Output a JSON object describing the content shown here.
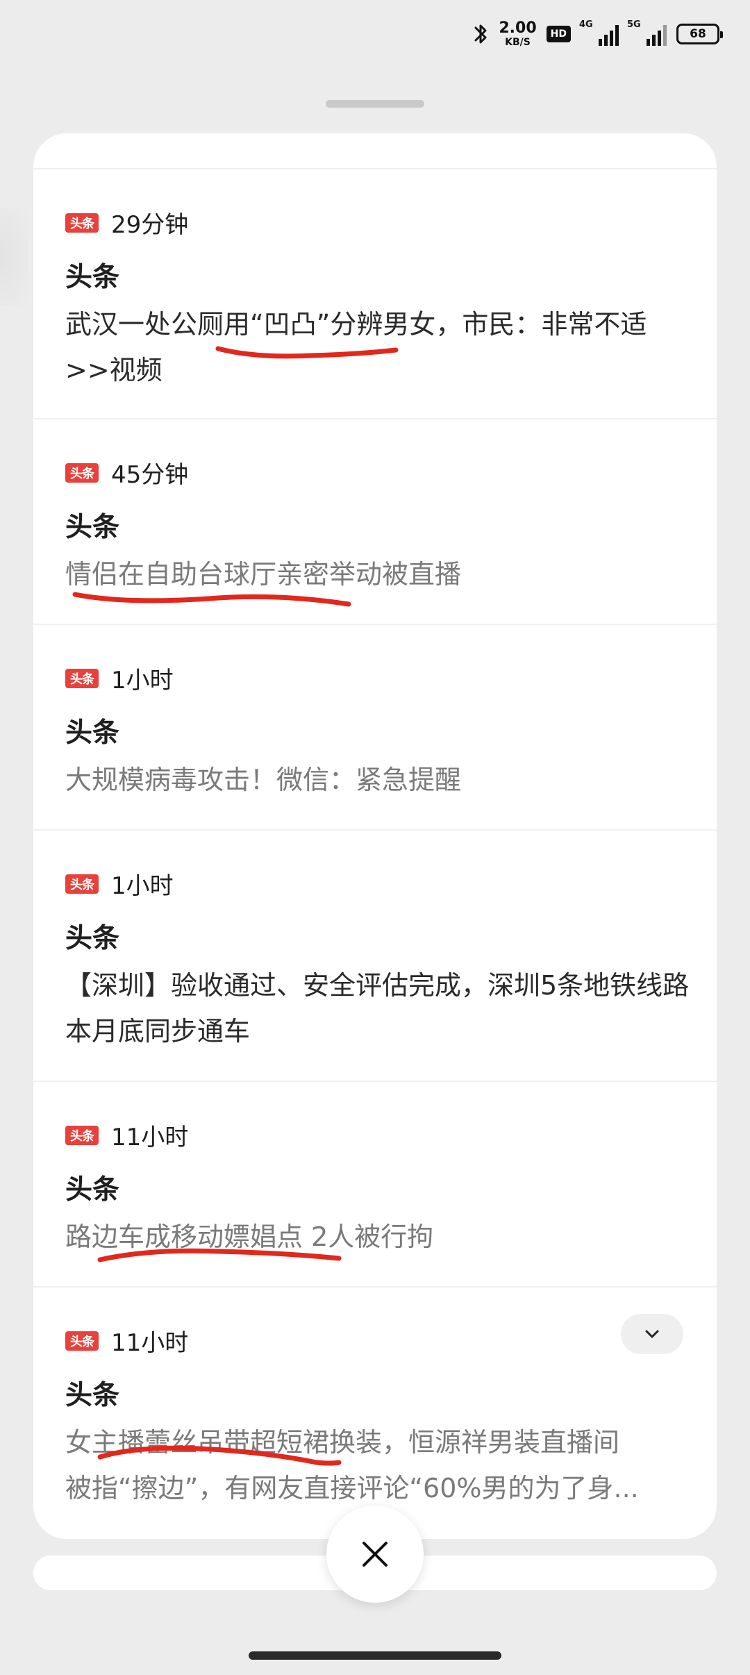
{
  "status_bar": {
    "net_speed_value": "2.00",
    "net_speed_unit": "KB/S",
    "hd_label": "HD",
    "signal1_label": "4G",
    "signal2_label": "5G",
    "battery_level": "68",
    "icons": [
      "bluetooth-icon",
      "hd-icon",
      "signal-4g-icon",
      "signal-5g-icon",
      "battery-icon"
    ]
  },
  "notifications": [
    {
      "app_icon_text": "头条",
      "time": "29分钟",
      "title": "头条",
      "body": "武汉一处公厕用“凹凸”分辨男女，市民：非常不适>>视频"
    },
    {
      "app_icon_text": "头条",
      "time": "45分钟",
      "title": "头条",
      "body": "情侣在自助台球厅亲密举动被直播"
    },
    {
      "app_icon_text": "头条",
      "time": "1小时",
      "title": "头条",
      "body": "大规模病毒攻击！微信：紧急提醒"
    },
    {
      "app_icon_text": "头条",
      "time": "1小时",
      "title": "头条",
      "body": "【深圳】验收通过、安全评估完成，深圳5条地铁线路本月底同步通车"
    },
    {
      "app_icon_text": "头条",
      "time": "11小时",
      "title": "头条",
      "body": "路边车成移动嫖娼点 2人被行拘"
    },
    {
      "app_icon_text": "头条",
      "time": "11小时",
      "title": "头条",
      "body_line1": "女主播蕾丝吊带超短裙换装，恒源祥男装直播间",
      "body_line2": "被指“擦边”，有网友直接评论“60%男的为了身..."
    }
  ],
  "colors": {
    "accent_red": "#e8413c",
    "background": "#ececec",
    "card": "#ffffff",
    "muted_text": "#7a7a7a"
  }
}
